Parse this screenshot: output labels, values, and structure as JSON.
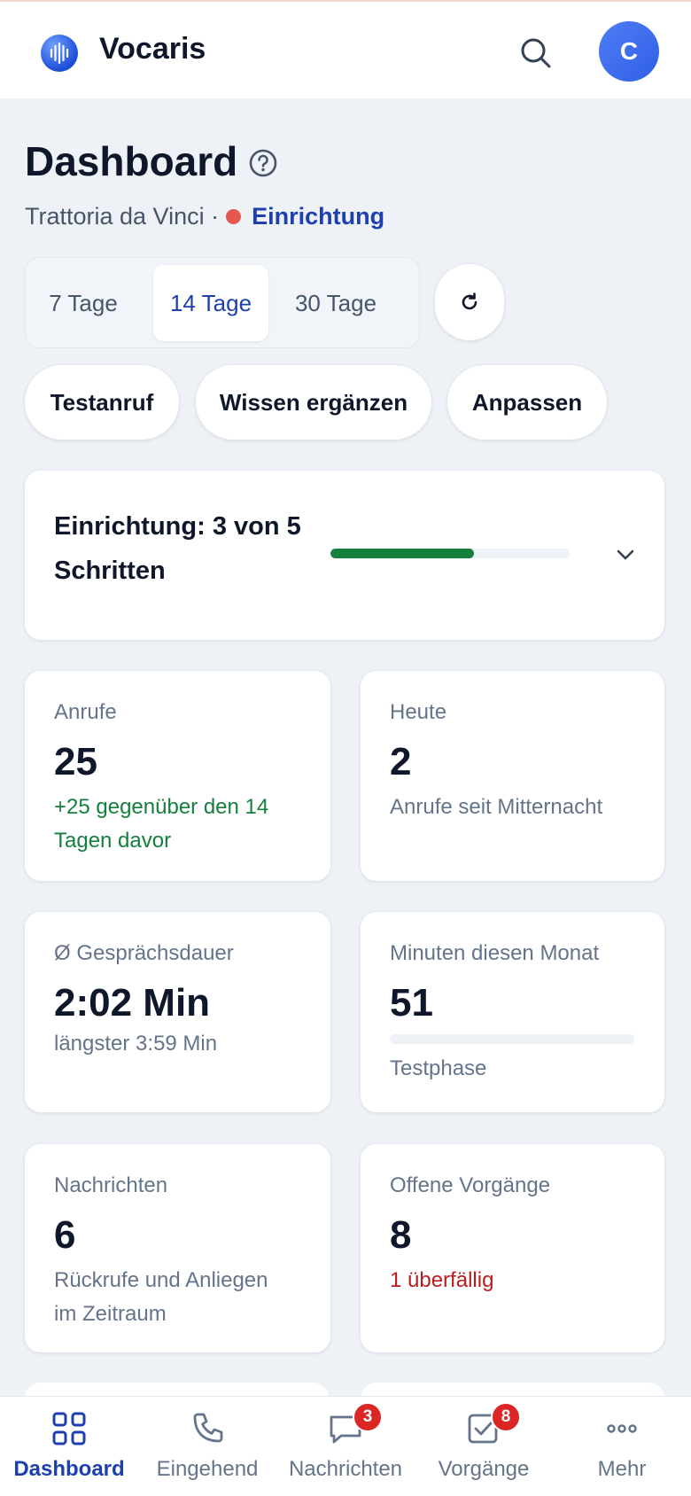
{
  "app": {
    "name": "Vocaris",
    "avatar_initial": "C"
  },
  "page": {
    "title": "Dashboard",
    "business": "Trattoria da Vinci ·",
    "status_label": "Einrichtung",
    "status_color": "#e5584f"
  },
  "range": {
    "options": [
      "7 Tage",
      "14 Tage",
      "30 Tage"
    ],
    "selected": "14 Tage"
  },
  "actions": [
    "Testanruf",
    "Wissen ergänzen",
    "Anpassen"
  ],
  "setup": {
    "title": "Einrichtung: 3 von 5 Schritten",
    "completed_steps": 3,
    "total_steps": 5,
    "progress_fraction": 0.6
  },
  "stats": [
    {
      "label": "Anrufe",
      "value": "25",
      "note": "+25 gegenüber den 14 Tagen davor",
      "note_tone": "green"
    },
    {
      "label": "Heute",
      "value": "2",
      "note": "Anrufe seit Mitternacht",
      "note_tone": "muted"
    },
    {
      "label": "Ø Gesprächsdauer",
      "value": "2:02 Min",
      "note": "längster 3:59 Min",
      "note_tone": "muted"
    },
    {
      "label": "Minuten diesen Monat",
      "value": "51",
      "note": "Testphase",
      "note_tone": "muted",
      "bar_fraction": 0
    },
    {
      "label": "Nachrichten",
      "value": "6",
      "note": "Rückrufe und Anliegen im Zeitraum",
      "note_tone": "muted"
    },
    {
      "label": "Offene Vorgänge",
      "value": "8",
      "note": "1 überfällig",
      "note_tone": "red"
    }
  ],
  "nav": [
    {
      "label": "Dashboard",
      "icon": "grid-icon",
      "active": true
    },
    {
      "label": "Eingehend",
      "icon": "phone-icon"
    },
    {
      "label": "Nachrichten",
      "icon": "message-icon",
      "badge": "3"
    },
    {
      "label": "Vorgänge",
      "icon": "task-check-icon",
      "badge": "8"
    },
    {
      "label": "Mehr",
      "icon": "more-dots-icon"
    }
  ],
  "colors": {
    "accent": "#1e40af",
    "success": "#15803d",
    "danger": "#dc2626"
  }
}
